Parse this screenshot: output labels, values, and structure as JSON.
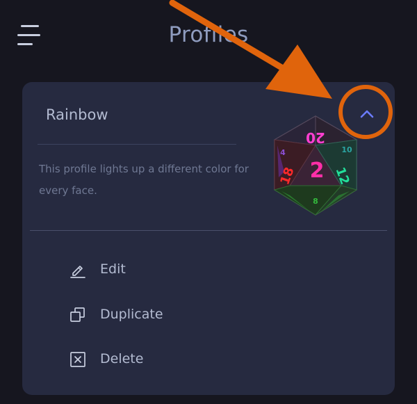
{
  "header": {
    "title": "Profiles",
    "menu_icon": "hamburger-menu-icon"
  },
  "profile": {
    "name": "Rainbow",
    "description": "This profile lights up a different color for every face.",
    "collapse_icon": "chevron-up-icon",
    "die_faces": [
      "20",
      "2",
      "18",
      "12",
      "4",
      "10",
      "8"
    ]
  },
  "actions": [
    {
      "label": "Edit",
      "icon": "pencil-icon"
    },
    {
      "label": "Duplicate",
      "icon": "duplicate-icon"
    },
    {
      "label": "Delete",
      "icon": "delete-box-icon"
    }
  ],
  "colors": {
    "background": "#16161f",
    "card": "#262a40",
    "text": "#b3bbd1",
    "muted_text": "#6f7893",
    "title": "#8f9cbf",
    "accent": "#6b7cff",
    "annotation": "#e0640c"
  }
}
